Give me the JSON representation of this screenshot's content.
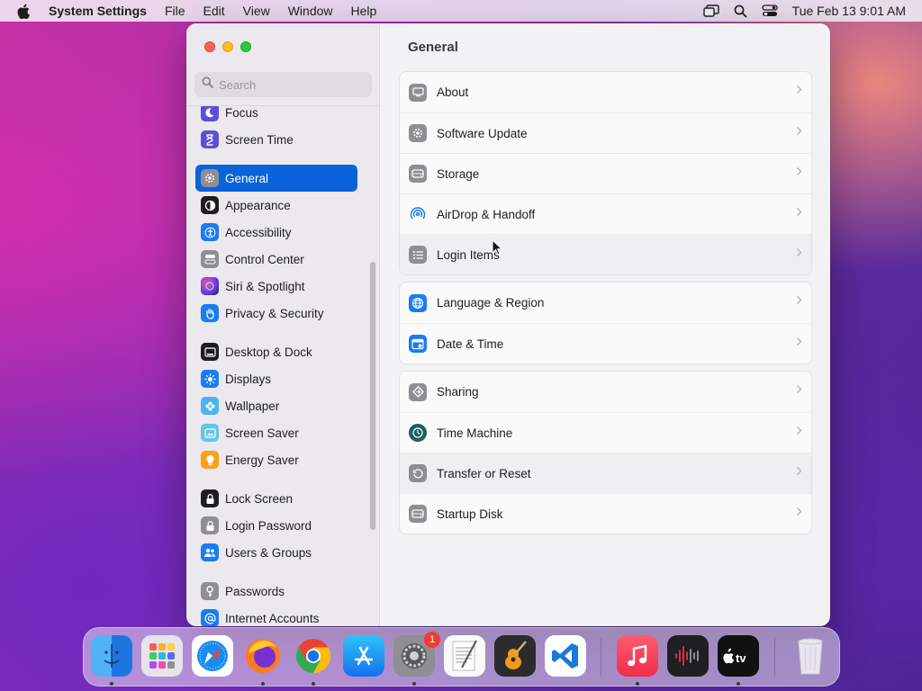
{
  "menubar": {
    "app_name": "System Settings",
    "items": [
      "File",
      "Edit",
      "View",
      "Window",
      "Help"
    ],
    "clock": "Tue Feb 13  9:01 AM"
  },
  "window": {
    "title": "General",
    "search_placeholder": "Search"
  },
  "sidebar": {
    "items": [
      {
        "label": "Focus",
        "icon": "moon-icon"
      },
      {
        "label": "Screen Time",
        "icon": "hourglass-icon"
      },
      {
        "label": "General",
        "icon": "gear-icon",
        "selected": true
      },
      {
        "label": "Appearance",
        "icon": "appearance-icon"
      },
      {
        "label": "Accessibility",
        "icon": "accessibility-icon"
      },
      {
        "label": "Control Center",
        "icon": "control-center-icon"
      },
      {
        "label": "Siri & Spotlight",
        "icon": "siri-icon"
      },
      {
        "label": "Privacy & Security",
        "icon": "hand-icon"
      },
      {
        "label": "Desktop & Dock",
        "icon": "dock-icon"
      },
      {
        "label": "Displays",
        "icon": "sun-icon"
      },
      {
        "label": "Wallpaper",
        "icon": "flower-icon"
      },
      {
        "label": "Screen Saver",
        "icon": "screensaver-icon"
      },
      {
        "label": "Energy Saver",
        "icon": "bulb-icon"
      },
      {
        "label": "Lock Screen",
        "icon": "lock-screen-icon"
      },
      {
        "label": "Login Password",
        "icon": "lock-icon"
      },
      {
        "label": "Users & Groups",
        "icon": "users-icon"
      },
      {
        "label": "Passwords",
        "icon": "key-icon"
      },
      {
        "label": "Internet Accounts",
        "icon": "at-icon"
      }
    ]
  },
  "main": {
    "groups": [
      [
        {
          "label": "About",
          "icon": "about-icon"
        },
        {
          "label": "Software Update",
          "icon": "software-update-icon"
        },
        {
          "label": "Storage",
          "icon": "storage-icon"
        },
        {
          "label": "AirDrop & Handoff",
          "icon": "airdrop-icon"
        },
        {
          "label": "Login Items",
          "icon": "list-icon"
        }
      ],
      [
        {
          "label": "Language & Region",
          "icon": "globe-icon"
        },
        {
          "label": "Date & Time",
          "icon": "calendar-icon"
        }
      ],
      [
        {
          "label": "Sharing",
          "icon": "sharing-icon"
        },
        {
          "label": "Time Machine",
          "icon": "time-machine-icon"
        },
        {
          "label": "Transfer or Reset",
          "icon": "reset-icon"
        },
        {
          "label": "Startup Disk",
          "icon": "disk-icon"
        }
      ]
    ]
  },
  "dock": {
    "apps": [
      "Finder",
      "Launchpad",
      "Safari",
      "Firefox",
      "Chrome",
      "App Store",
      "System Settings",
      "TextEdit",
      "GarageBand",
      "Visual Studio Code",
      "Music",
      "Voice Memos",
      "TV",
      "Trash"
    ],
    "settings_badge": "1"
  },
  "colors": {
    "accent": "#0a63d8",
    "window_bg": "#f2f1f3",
    "sidebar_bg": "#ebe9ed"
  }
}
